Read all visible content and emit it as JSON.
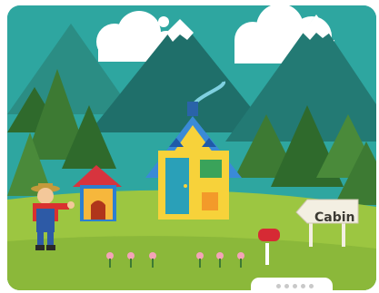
{
  "scene": {
    "sign_label": "Cabin"
  },
  "colors": {
    "sky": "#2ea6a0",
    "mountain_dark": "#1f6f6a",
    "mountain_mid": "#2b8d84",
    "snow": "#ffffff",
    "forest": "#3d7a33",
    "grass": "#9cc641",
    "cabin_body": "#f7d23a",
    "cabin_roof": "#3a8ad7",
    "cabin_door": "#2aa0b8",
    "doghouse_body": "#f6b73c",
    "mailbox": "#d62a34",
    "farmer_shirt": "#d9312f",
    "farmer_overalls": "#2d5aa6",
    "sign": "#f3efe2"
  },
  "pager": {
    "dots": 5
  }
}
